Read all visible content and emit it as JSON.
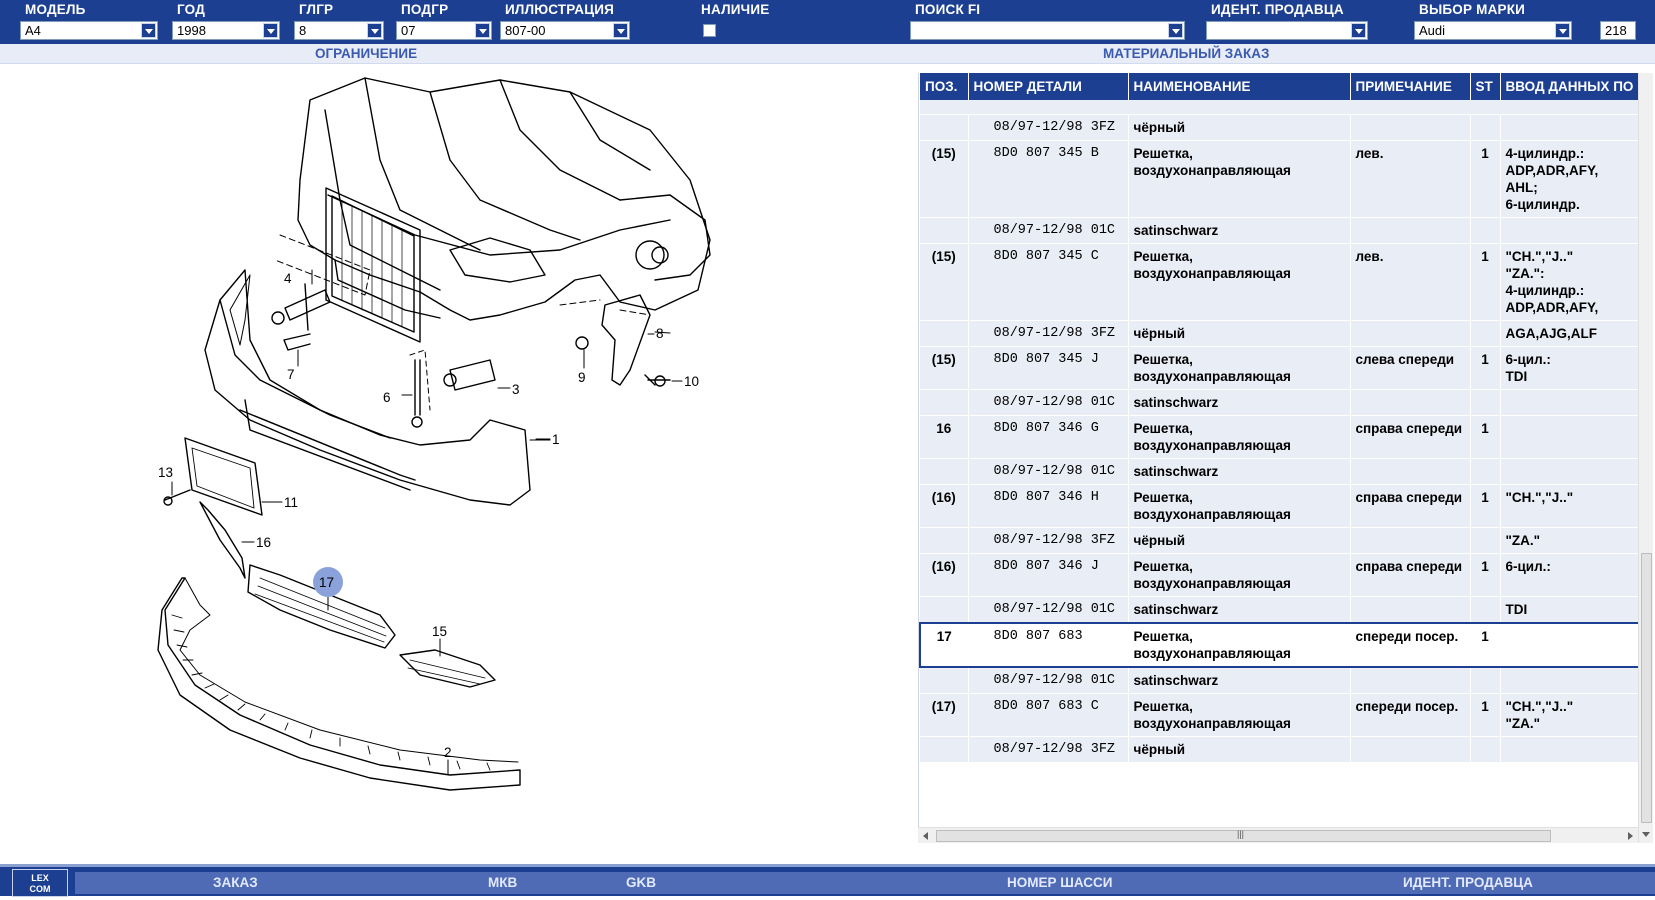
{
  "filters": {
    "model": {
      "label": "МОДЕЛЬ",
      "value": "A4"
    },
    "year": {
      "label": "ГОД",
      "value": "1998"
    },
    "main_group": {
      "label": "ГЛГР",
      "value": "8"
    },
    "sub_group": {
      "label": "ПОДГР",
      "value": "07"
    },
    "illustration": {
      "label": "ИЛЛЮСТРАЦИЯ",
      "value": "807-00"
    },
    "availability": {
      "label": "НАЛИЧИЕ"
    },
    "search_fi": {
      "label": "ПОИСК FI",
      "value": ""
    },
    "seller_id": {
      "label": "ИДЕНТ. ПРОДАВЦА",
      "value": ""
    },
    "brand": {
      "label": "ВЫБОР МАРКИ",
      "value": "Audi"
    },
    "brand_code": "218"
  },
  "sections": {
    "left": "ОГРАНИЧЕНИЕ",
    "right": "МАТЕРИАЛЬНЫЙ ЗАКАЗ"
  },
  "diagram": {
    "callouts": [
      "1",
      "2",
      "3",
      "4",
      "6",
      "7",
      "8",
      "9",
      "10",
      "11",
      "13",
      "15",
      "16",
      "17"
    ],
    "highlighted": "17"
  },
  "table": {
    "headers": [
      "ПОЗ.",
      "НОМЕР ДЕТАЛИ",
      "НАИМЕНОВАНИЕ",
      "ПРИМЕЧАНИЕ",
      "ST",
      "ВВОД ДАННЫХ ПО"
    ],
    "rows": [
      {
        "pos": "",
        "part": "08/97-12/98 3FZ",
        "name": "чёрный",
        "note": "",
        "st": "",
        "data": ""
      },
      {
        "pos": "(15)",
        "part": "8D0 807 345 B",
        "name": "Решетка, воздухонаправляющая",
        "note": "лев.",
        "st": "1",
        "data": "4-цилиндр.:\nADP,ADR,AFY,\nAHL;\n6-цилиндр."
      },
      {
        "pos": "",
        "part": "08/97-12/98 01C",
        "name": "satinschwarz",
        "note": "",
        "st": "",
        "data": ""
      },
      {
        "pos": "(15)",
        "part": "8D0 807 345 C",
        "name": "Решетка, воздухонаправляющая",
        "note": "лев.",
        "st": "1",
        "data": "\"CH.\",\"J..\"\n\"ZA.\":\n4-цилиндр.:\nADP,ADR,AFY,"
      },
      {
        "pos": "",
        "part": "08/97-12/98 3FZ",
        "name": "чёрный",
        "note": "",
        "st": "",
        "data": "AGA,AJG,ALF"
      },
      {
        "pos": "(15)",
        "part": "8D0 807 345 J",
        "name": "Решетка, воздухонаправляющая",
        "note": "слева спереди",
        "st": "1",
        "data": "6-цил.:\nTDI"
      },
      {
        "pos": "",
        "part": "08/97-12/98 01C",
        "name": "satinschwarz",
        "note": "",
        "st": "",
        "data": ""
      },
      {
        "pos": "16",
        "part": "8D0 807 346 G",
        "name": "Решетка, воздухонаправляющая",
        "note": "справа спереди",
        "st": "1",
        "data": ""
      },
      {
        "pos": "",
        "part": "08/97-12/98 01C",
        "name": "satinschwarz",
        "note": "",
        "st": "",
        "data": ""
      },
      {
        "pos": "(16)",
        "part": "8D0 807 346 H",
        "name": "Решетка, воздухонаправляющая",
        "note": "справа спереди",
        "st": "1",
        "data": "\"CH.\",\"J..\""
      },
      {
        "pos": "",
        "part": "08/97-12/98 3FZ",
        "name": "чёрный",
        "note": "",
        "st": "",
        "data": "\"ZA.\""
      },
      {
        "pos": "(16)",
        "part": "8D0 807 346 J",
        "name": "Решетка, воздухонаправляющая",
        "note": "справа спереди",
        "st": "1",
        "data": "6-цил.:"
      },
      {
        "pos": "",
        "part": "08/97-12/98 01C",
        "name": "satinschwarz",
        "note": "",
        "st": "",
        "data": "TDI"
      },
      {
        "pos": "17",
        "part": "8D0 807 683",
        "name": "Решетка, воздухонаправляющая",
        "note": "спереди посер.",
        "st": "1",
        "data": "",
        "selected": true
      },
      {
        "pos": "",
        "part": "08/97-12/98 01C",
        "name": "satinschwarz",
        "note": "",
        "st": "",
        "data": ""
      },
      {
        "pos": "(17)",
        "part": "8D0 807 683 C",
        "name": "Решетка, воздухонаправляющая",
        "note": "спереди посер.",
        "st": "1",
        "data": "\"CH.\",\"J..\"\n\"ZA.\""
      },
      {
        "pos": "",
        "part": "08/97-12/98 3FZ",
        "name": "чёрный",
        "note": "",
        "st": "",
        "data": ""
      }
    ]
  },
  "bottom": {
    "logo": "LEX\nCOM",
    "buttons": [
      "ЗАКАЗ",
      "МКВ",
      "GKB",
      "НОМЕР ШАССИ",
      "ИДЕНТ. ПРОДАВЦА"
    ]
  },
  "colors": {
    "bar": "#1c3f92",
    "row": "#e9edf5",
    "highlight": "#8aa2d9"
  }
}
